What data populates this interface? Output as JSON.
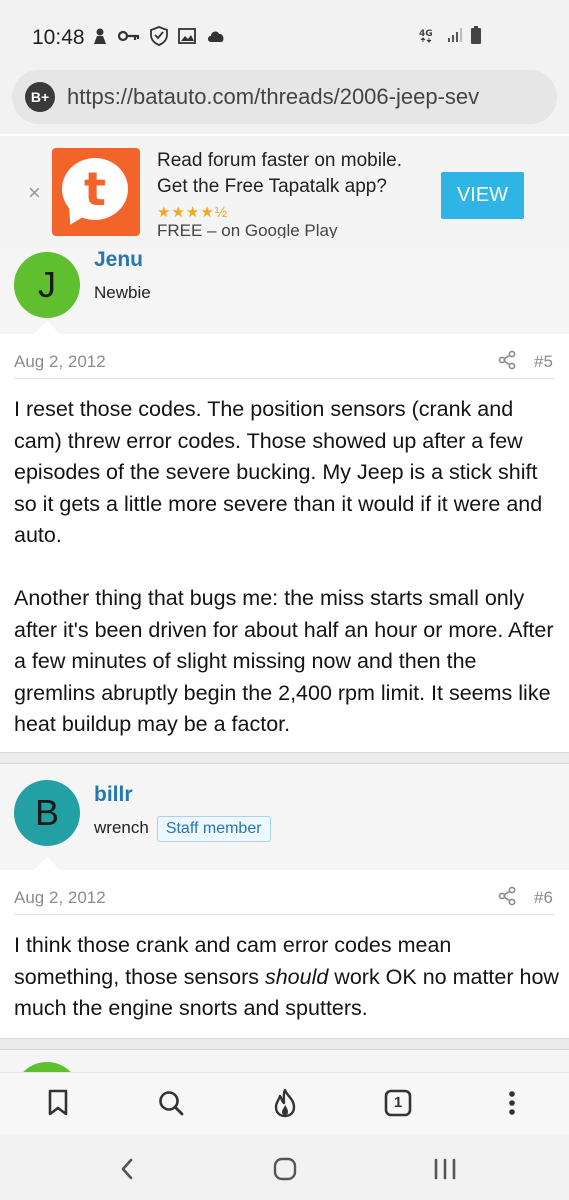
{
  "status_bar": {
    "time": "10:48"
  },
  "url_bar": {
    "badge": "B+",
    "url": "https://batauto.com/threads/2006-jeep-sev"
  },
  "banner": {
    "close": "×",
    "line1": "Read forum faster on mobile.",
    "line2": "Get the Free Tapatalk app?",
    "stars": "★★★★½",
    "line3": "FREE – on Google Play",
    "logo_letter": "t",
    "view_label": "VIEW"
  },
  "posts": [
    {
      "avatar_letter": "J",
      "avatar_color": "#5fbf2e",
      "username": "Jenu",
      "user_title": "Newbie",
      "date": "Aug 2, 2012",
      "number": "#5",
      "paragraphs": [
        "I reset those codes. The position sensors (crank and cam) threw error codes. Those showed up after a few episodes of the severe bucking. My Jeep is a stick shift so it gets a little more severe than it would if it were and auto.",
        "Another thing that bugs me: the miss starts small only after it's been driven for about half an hour or more. After a few minutes of slight missing now and then the gremlins abruptly begin the 2,400 rpm limit. It seems like heat buildup may be a factor."
      ]
    },
    {
      "avatar_letter": "B",
      "avatar_color": "#23a0a3",
      "username": "billr",
      "user_title": "wrench",
      "badge": "Staff member",
      "date": "Aug 2, 2012",
      "number": "#6",
      "text_before": "I think those crank and cam error codes mean something, those sensors ",
      "text_em": "should",
      "text_after": " work OK no matter how much the engine snorts and sputters."
    }
  ],
  "toolbar": {
    "tabs_count": "1"
  },
  "colors": {
    "accent": "#2577b1",
    "tapatalk": "#f2642a",
    "view_button": "#2eb5e5"
  }
}
